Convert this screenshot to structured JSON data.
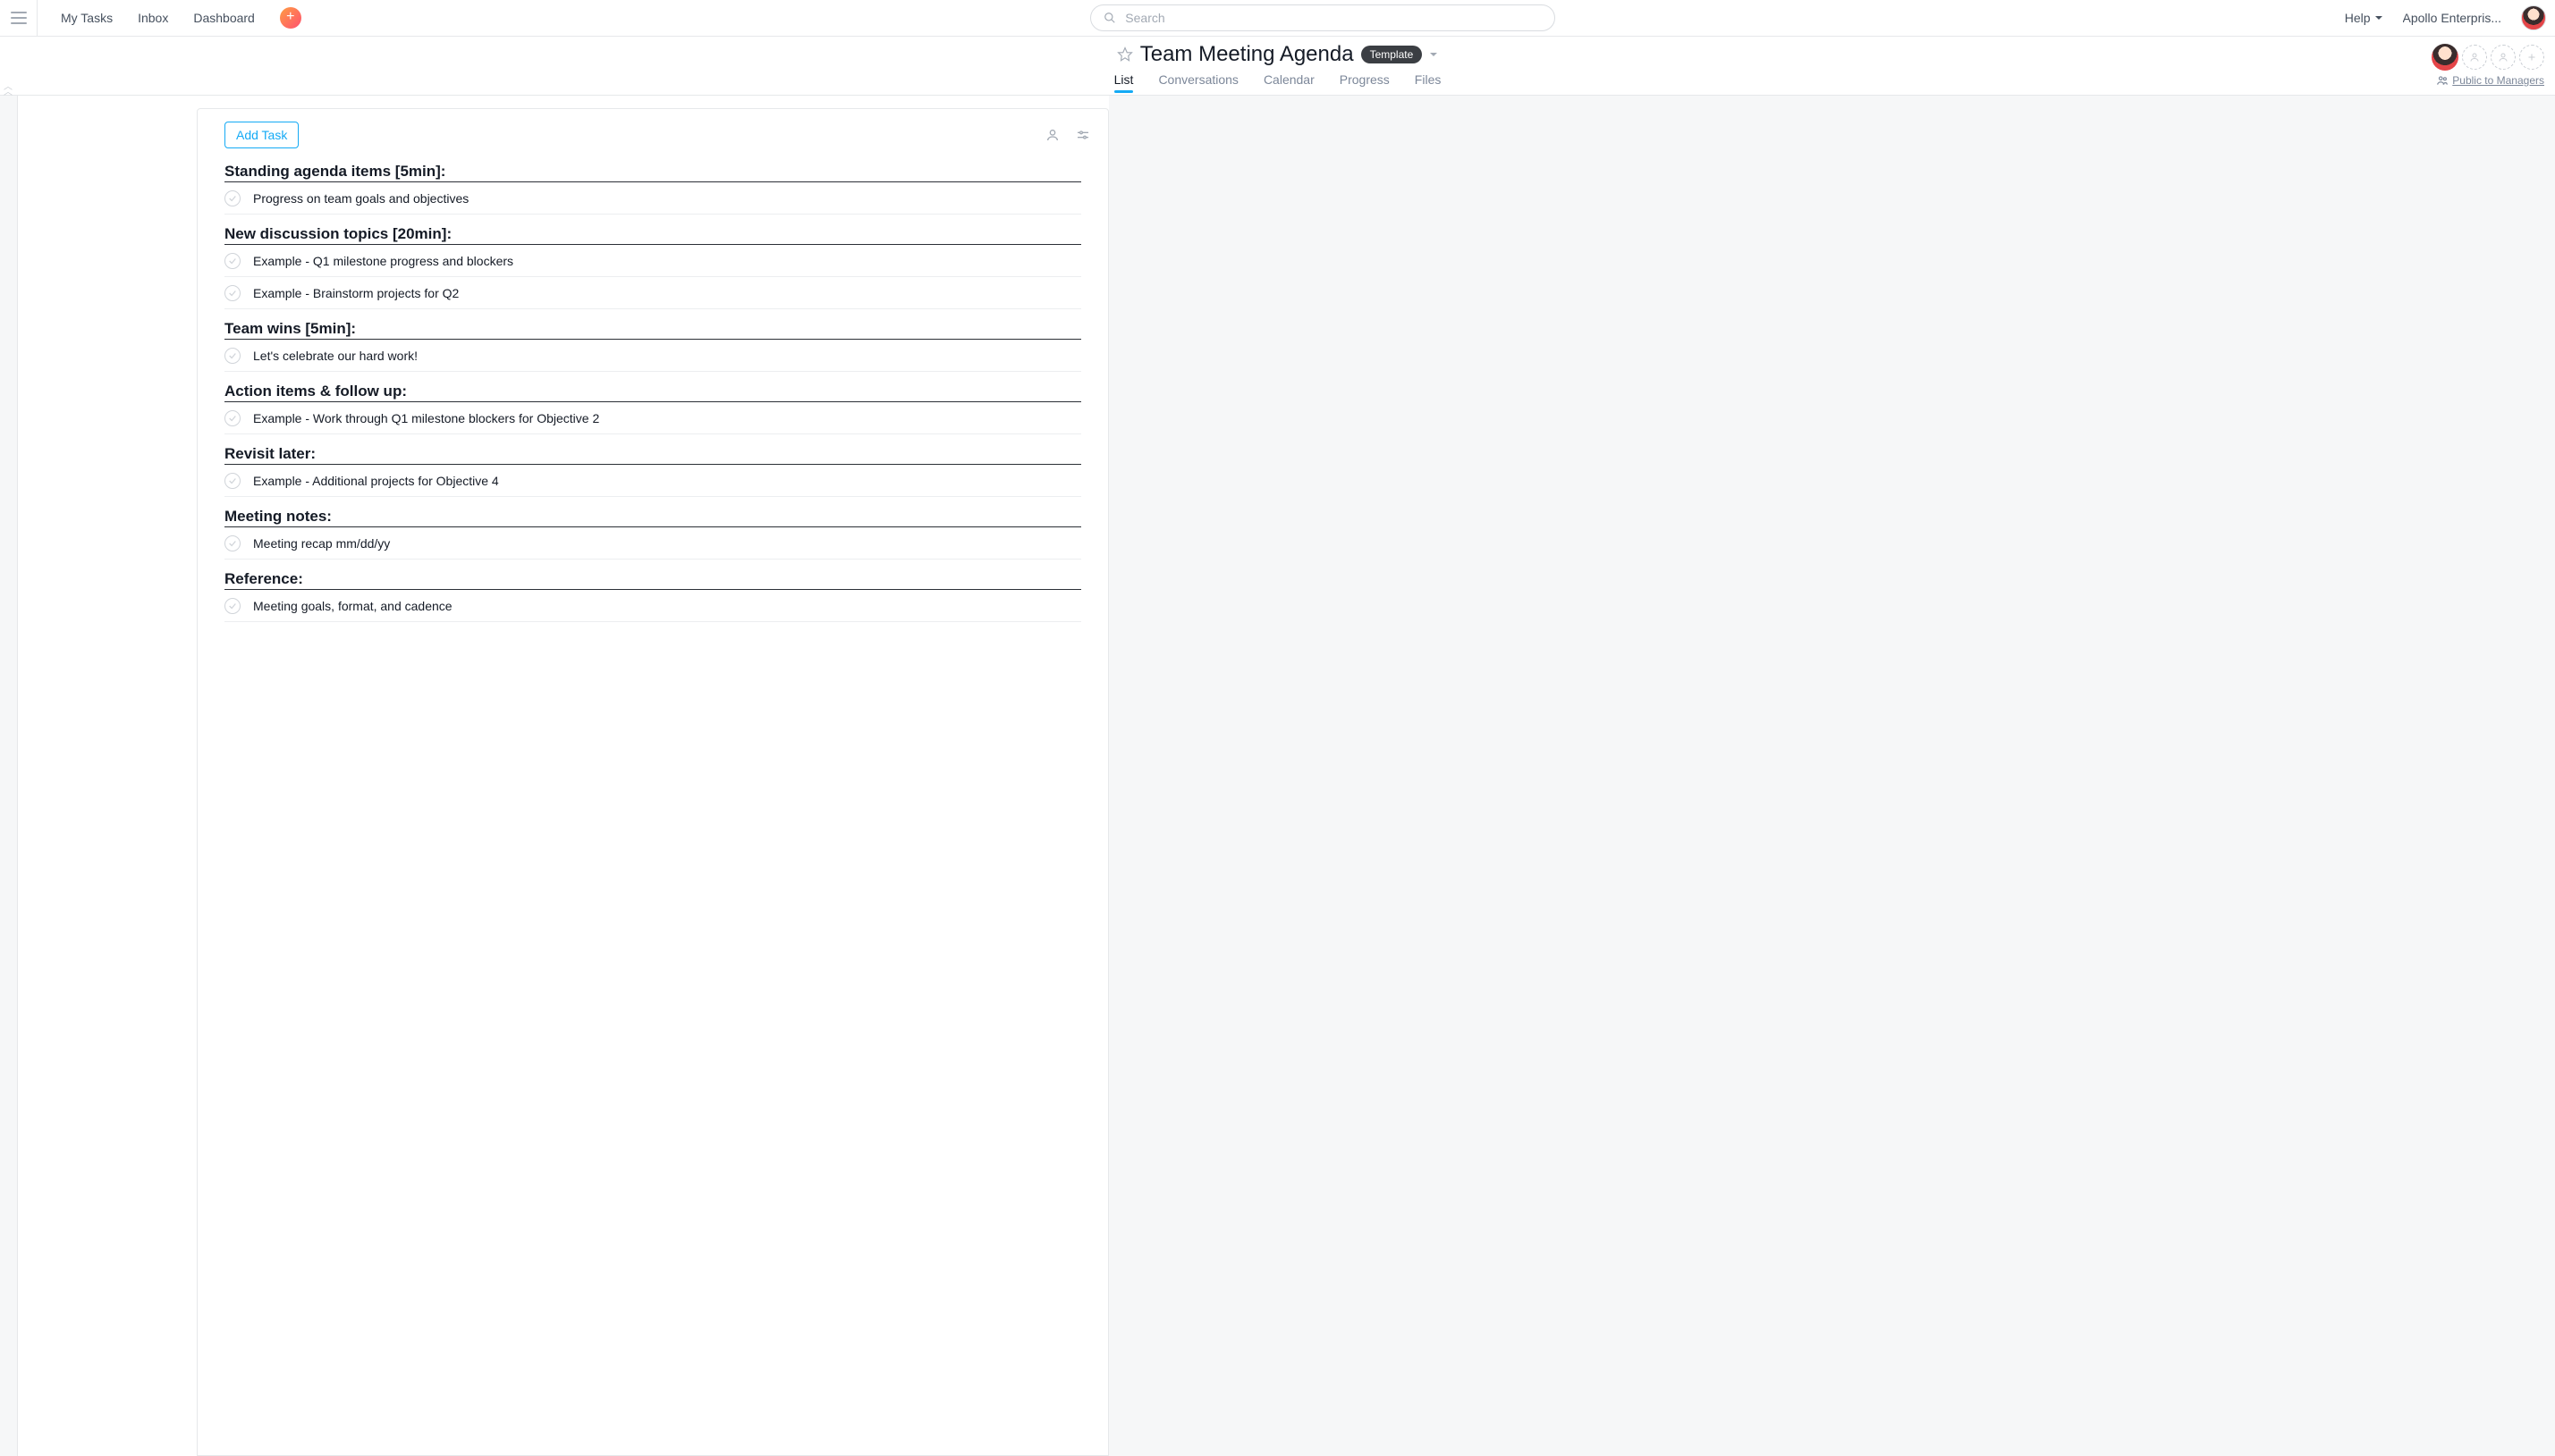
{
  "nav": {
    "my_tasks": "My Tasks",
    "inbox": "Inbox",
    "dashboard": "Dashboard"
  },
  "search": {
    "placeholder": "Search"
  },
  "help_label": "Help",
  "org_label": "Apollo Enterpris...",
  "project": {
    "title": "Team Meeting Agenda",
    "badge": "Template",
    "visibility": "Public to Managers"
  },
  "tabs": {
    "list": "List",
    "conversations": "Conversations",
    "calendar": "Calendar",
    "progress": "Progress",
    "files": "Files",
    "active": "list"
  },
  "add_task_label": "Add Task",
  "sections": [
    {
      "title": "Standing agenda items [5min]:",
      "tasks": [
        "Progress on team goals and objectives"
      ]
    },
    {
      "title": "New discussion topics [20min]:",
      "tasks": [
        "Example - Q1 milestone progress and blockers",
        "Example - Brainstorm projects for Q2"
      ]
    },
    {
      "title": "Team wins [5min]:",
      "tasks": [
        "Let's celebrate our hard work!"
      ]
    },
    {
      "title": "Action items & follow up:",
      "tasks": [
        "Example - Work through Q1 milestone blockers for Objective 2"
      ]
    },
    {
      "title": "Revisit later:",
      "tasks": [
        "Example - Additional projects for Objective 4"
      ]
    },
    {
      "title": "Meeting notes:",
      "tasks": [
        "Meeting recap mm/dd/yy"
      ]
    },
    {
      "title": "Reference:",
      "tasks": [
        "Meeting goals, format, and cadence"
      ]
    }
  ]
}
